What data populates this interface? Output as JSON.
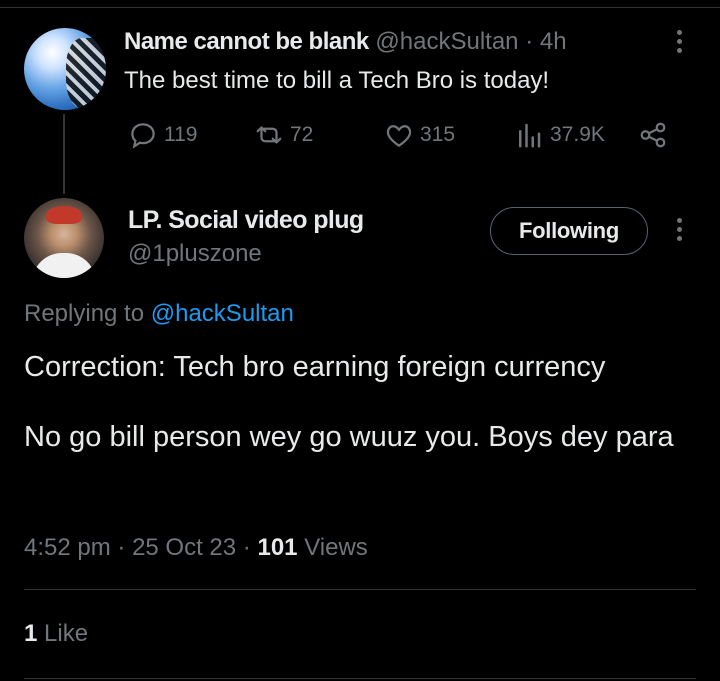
{
  "parent_tweet": {
    "author_name": "Name cannot be blank",
    "handle": "@hackSultan",
    "separator": "·",
    "time_ago": "4h",
    "text": "The best time to bill a Tech Bro is today!",
    "actions": {
      "replies": "119",
      "retweets": "72",
      "likes": "315",
      "views": "37.9K"
    }
  },
  "main_tweet": {
    "author_name": "LP. Social video plug",
    "handle": "@1pluszone",
    "follow_label": "Following",
    "replying_prefix": "Replying to",
    "replying_handle": "@hackSultan",
    "text_line1": "Correction: Tech bro earning foreign currency",
    "text_line2": "No go bill person wey go wuuz you. Boys dey para",
    "time": "4:52 pm",
    "date": "25 Oct 23",
    "views_count": "101",
    "views_label": "Views",
    "sep": "·",
    "likes_count": "1",
    "likes_label": "Like"
  },
  "icons": [
    "reply-icon",
    "retweet-icon",
    "like-icon",
    "views-icon",
    "share-icon",
    "more-icon"
  ],
  "colors": {
    "background": "#000000",
    "text": "#e7e9ea",
    "muted": "#71767b",
    "link": "#1d9bf0",
    "border": "#2f3336"
  }
}
